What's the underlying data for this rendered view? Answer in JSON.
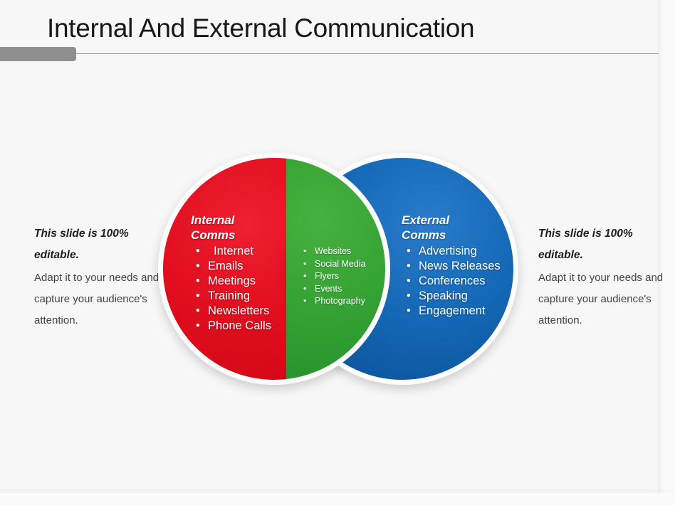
{
  "slide": {
    "title": "Internal And External Communication",
    "background_color": "#f7f7f8",
    "accent_bar_color": "#8f8f8f"
  },
  "side_notes": {
    "left": {
      "lead": "This slide is 100% editable.",
      "body": "Adapt it to your needs and capture your audience's attention."
    },
    "right": {
      "lead": "This slide is 100% editable.",
      "body": "Adapt it to your needs and capture your audience's attention."
    }
  },
  "venn": {
    "bullet_glyph": "•",
    "left_circle": {
      "heading": "Internal\nComms",
      "color": "#e10f1f",
      "items": [
        "Internet",
        "Emails",
        "Meetings",
        "Training",
        "Newsletters",
        "Phone Calls"
      ]
    },
    "intersection": {
      "heading": "",
      "color": "#33a033",
      "items": [
        "Websites",
        "Social Media",
        "Flyers",
        "Events",
        "Photography"
      ]
    },
    "right_circle": {
      "heading": "External\nComms",
      "color": "#1468b6",
      "items": [
        "Advertising",
        "News Releases",
        "Conferences",
        "Speaking",
        "Engagement"
      ]
    }
  }
}
